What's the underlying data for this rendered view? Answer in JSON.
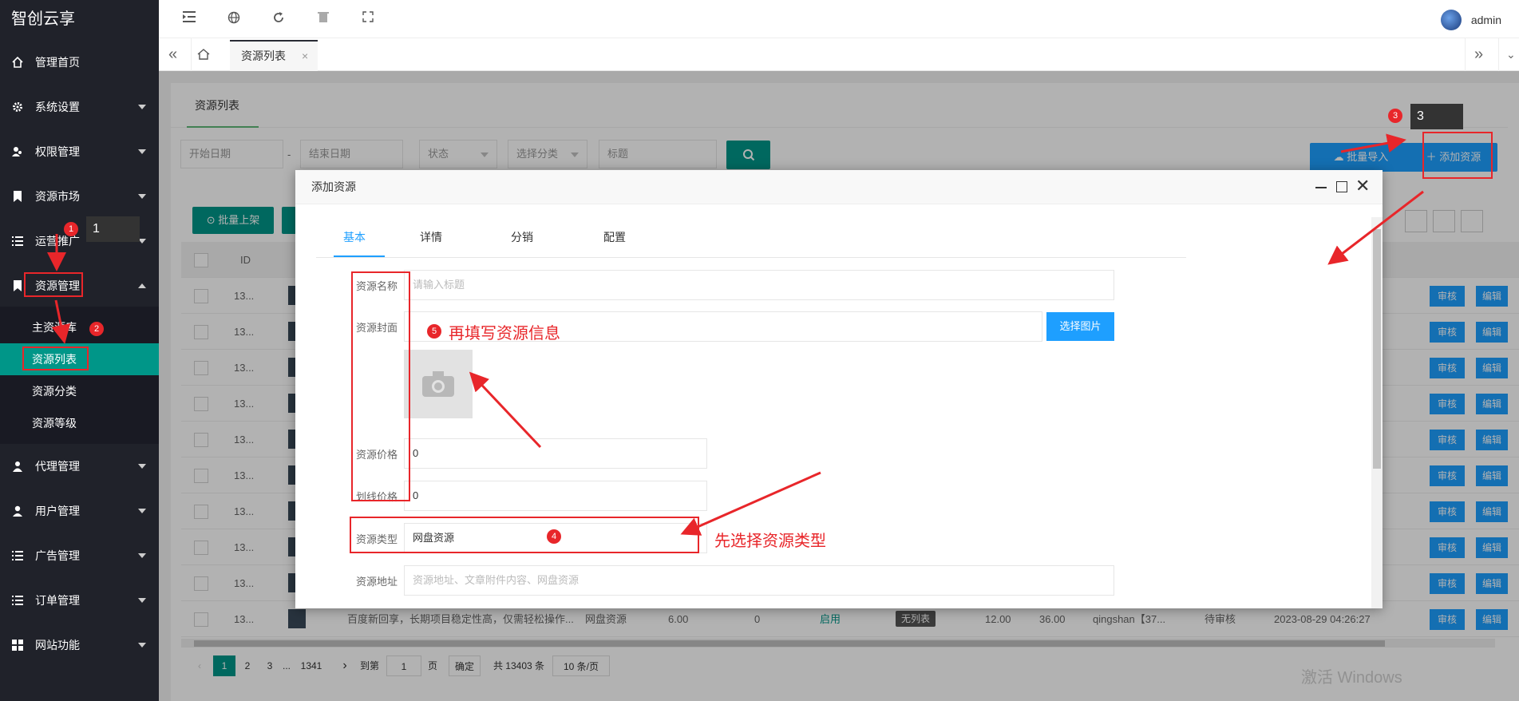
{
  "app": {
    "name": "智创云享"
  },
  "sidebar": {
    "items": [
      {
        "label": "管理首页",
        "icon": "home-icon",
        "arrow": false
      },
      {
        "label": "系统设置",
        "icon": "gear-icon",
        "arrow": true
      },
      {
        "label": "权限管理",
        "icon": "users-icon",
        "arrow": true
      },
      {
        "label": "资源市场",
        "icon": "bookmark-icon",
        "arrow": true
      },
      {
        "label": "运营推广",
        "icon": "list-icon",
        "arrow": true
      },
      {
        "label": "资源管理",
        "icon": "bookmark-icon",
        "arrow": true
      },
      {
        "label": "代理管理",
        "icon": "user-group-icon",
        "arrow": true
      },
      {
        "label": "用户管理",
        "icon": "user-icon",
        "arrow": true
      },
      {
        "label": "广告管理",
        "icon": "list-icon",
        "arrow": true
      },
      {
        "label": "订单管理",
        "icon": "list-icon",
        "arrow": true
      },
      {
        "label": "网站功能",
        "icon": "grid-icon",
        "arrow": true
      }
    ],
    "submenu": [
      {
        "label": "主资源库"
      },
      {
        "label": "资源列表"
      },
      {
        "label": "资源分类"
      },
      {
        "label": "资源等级"
      }
    ]
  },
  "topbar": {
    "user": "admin"
  },
  "tabs": {
    "active": "资源列表",
    "close": "×"
  },
  "page": {
    "card_tab": "资源列表",
    "filters": {
      "start_date": "开始日期",
      "separator": "-",
      "end_date": "结束日期",
      "status": "状态",
      "category": "选择分类",
      "title": "标题"
    },
    "batch_import": "批量导入",
    "add_resource": "添加资源",
    "batch_shelf": "批量上架",
    "table": {
      "header_id": "ID",
      "rows": [
        {
          "id": "13..."
        },
        {
          "id": "13..."
        },
        {
          "id": "13..."
        },
        {
          "id": "13..."
        },
        {
          "id": "13..."
        },
        {
          "id": "13..."
        },
        {
          "id": "13..."
        },
        {
          "id": "13..."
        },
        {
          "id": "13..."
        },
        {
          "id": "13...",
          "title": "百度新回享，长期项目稳定性高，仅需轻松操作...",
          "type": "网盘资源",
          "price": "6.00",
          "count": "0",
          "status": "启用",
          "tag": "无列表",
          "v1": "12.00",
          "v2": "36.00",
          "user": "qingshan【37...",
          "audit": "待审核",
          "time": "2023-08-29 04:26:27"
        }
      ],
      "audit_btn": "审核",
      "edit_btn": "编辑"
    },
    "pagination": {
      "pages": [
        "1",
        "2",
        "3",
        "...",
        "1341"
      ],
      "goto": "到第",
      "goto_value": "1",
      "page_unit": "页",
      "confirm": "确定",
      "total": "共 13403 条",
      "page_size": "10 条/页"
    }
  },
  "dialog": {
    "title": "添加资源",
    "tabs": [
      "基本",
      "详情",
      "分销",
      "配置"
    ],
    "fields": {
      "name_label": "资源名称",
      "name_placeholder": "请输入标题",
      "cover_label": "资源封面",
      "choose_image": "选择图片",
      "price_label": "资源价格",
      "price_value": "0",
      "strike_label": "划线价格",
      "strike_value": "0",
      "type_label": "资源类型",
      "type_value": "网盘资源",
      "url_label": "资源地址",
      "url_placeholder": "资源地址、文章附件内容、网盘资源"
    }
  },
  "annotations": {
    "b1": "1",
    "b2": "2",
    "b3": "3",
    "b4": "4",
    "b5": "5",
    "tip1": "1",
    "tip3": "3",
    "text5": "再填写资源信息",
    "text4": "先选择资源类型"
  },
  "watermark": "激活 Windows",
  "colors": {
    "sidebar": "#20222a",
    "teal": "#009688",
    "blue": "#1e9fff",
    "annotation": "#e8262a"
  }
}
